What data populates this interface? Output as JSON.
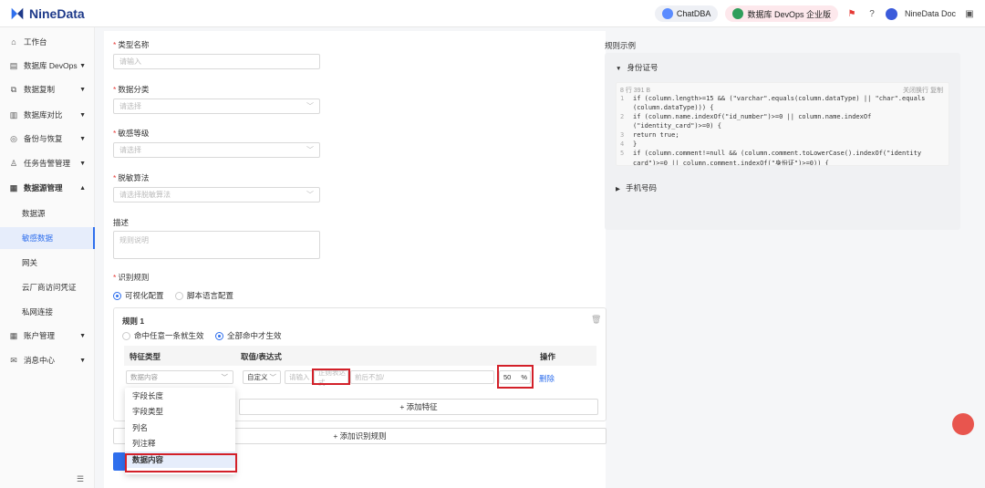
{
  "brand": {
    "name": "NineData"
  },
  "topbar": {
    "chatdba": "ChatDBA",
    "edition": "数据库 DevOps 企业版",
    "doc": "NineData Doc"
  },
  "sidebar": {
    "items": [
      {
        "label": "工作台",
        "icon": "home-icon"
      },
      {
        "label": "数据库 DevOps",
        "icon": "database-icon"
      },
      {
        "label": "数据复制",
        "icon": "copy-icon"
      },
      {
        "label": "数据库对比",
        "icon": "compare-icon"
      },
      {
        "label": "备份与恢复",
        "icon": "backup-icon"
      },
      {
        "label": "任务告警管理",
        "icon": "alarm-icon"
      },
      {
        "label": "数据源管理",
        "icon": "datasource-icon"
      },
      {
        "label": "数据源"
      },
      {
        "label": "敏感数据"
      },
      {
        "label": "网关"
      },
      {
        "label": "云厂商访问凭证"
      },
      {
        "label": "私网连接"
      },
      {
        "label": "账户管理",
        "icon": "account-icon"
      },
      {
        "label": "消息中心",
        "icon": "message-icon"
      }
    ]
  },
  "form": {
    "type_name": {
      "label": "类型名称",
      "placeholder": "请输入"
    },
    "data_category": {
      "label": "数据分类",
      "placeholder": "请选择"
    },
    "sensitivity": {
      "label": "敏感等级",
      "placeholder": "请选择"
    },
    "masking": {
      "label": "脱敏算法",
      "placeholder": "请选择脱敏算法"
    },
    "description": {
      "label": "描述",
      "placeholder": "规则说明"
    },
    "rules": {
      "label": "识别规则",
      "options": [
        "可视化配置",
        "脚本语言配置"
      ],
      "selected": "可视化配置"
    }
  },
  "rule": {
    "title": "规则 1",
    "modes": [
      "命中任意一条就生效",
      "全部命中才生效"
    ],
    "selected_mode": "全部命中才生效",
    "columns": [
      "特征类型",
      "取值/表达式",
      "操作"
    ],
    "row": {
      "feature_type": "数据内容",
      "match_mode": "自定义",
      "expr1": "请输入",
      "expr2": "正则表达式",
      "expr3": "前后不加/",
      "percent": "50",
      "percent_unit": "%",
      "delete": "删除"
    },
    "add_feature": "+ 添加特征",
    "add_rule": "+ 添加识别规则"
  },
  "dropdown": {
    "options": [
      "字段长度",
      "字段类型",
      "列名",
      "列注释",
      "数据内容"
    ],
    "selected": "数据内容"
  },
  "example": {
    "title": "规则示例",
    "sections": [
      "身份证号",
      "手机号码"
    ],
    "meta": "8 行  391 B",
    "actions": "关闭换行  复制",
    "code": [
      {
        "n": "1",
        "t": "if (column.length>=15 && (\"varchar\".equals(column.dataType) || \"char\".equals"
      },
      {
        "n": "",
        "t": "(column.dataType))) {"
      },
      {
        "n": "2",
        "t": "    if (column.name.indexOf(\"id_number\")>=0 || column.name.indexOf"
      },
      {
        "n": "",
        "t": "    (\"identity_card\")>=0) {"
      },
      {
        "n": "3",
        "t": "      return true;"
      },
      {
        "n": "4",
        "t": "    }"
      },
      {
        "n": "5",
        "t": "    if (column.comment!=null && (column.comment.toLowerCase().indexOf(\"identity"
      },
      {
        "n": "",
        "t": "    card\")>=0 || column.comment.indexOf(\"身份证\")>=0)) {"
      }
    ]
  }
}
